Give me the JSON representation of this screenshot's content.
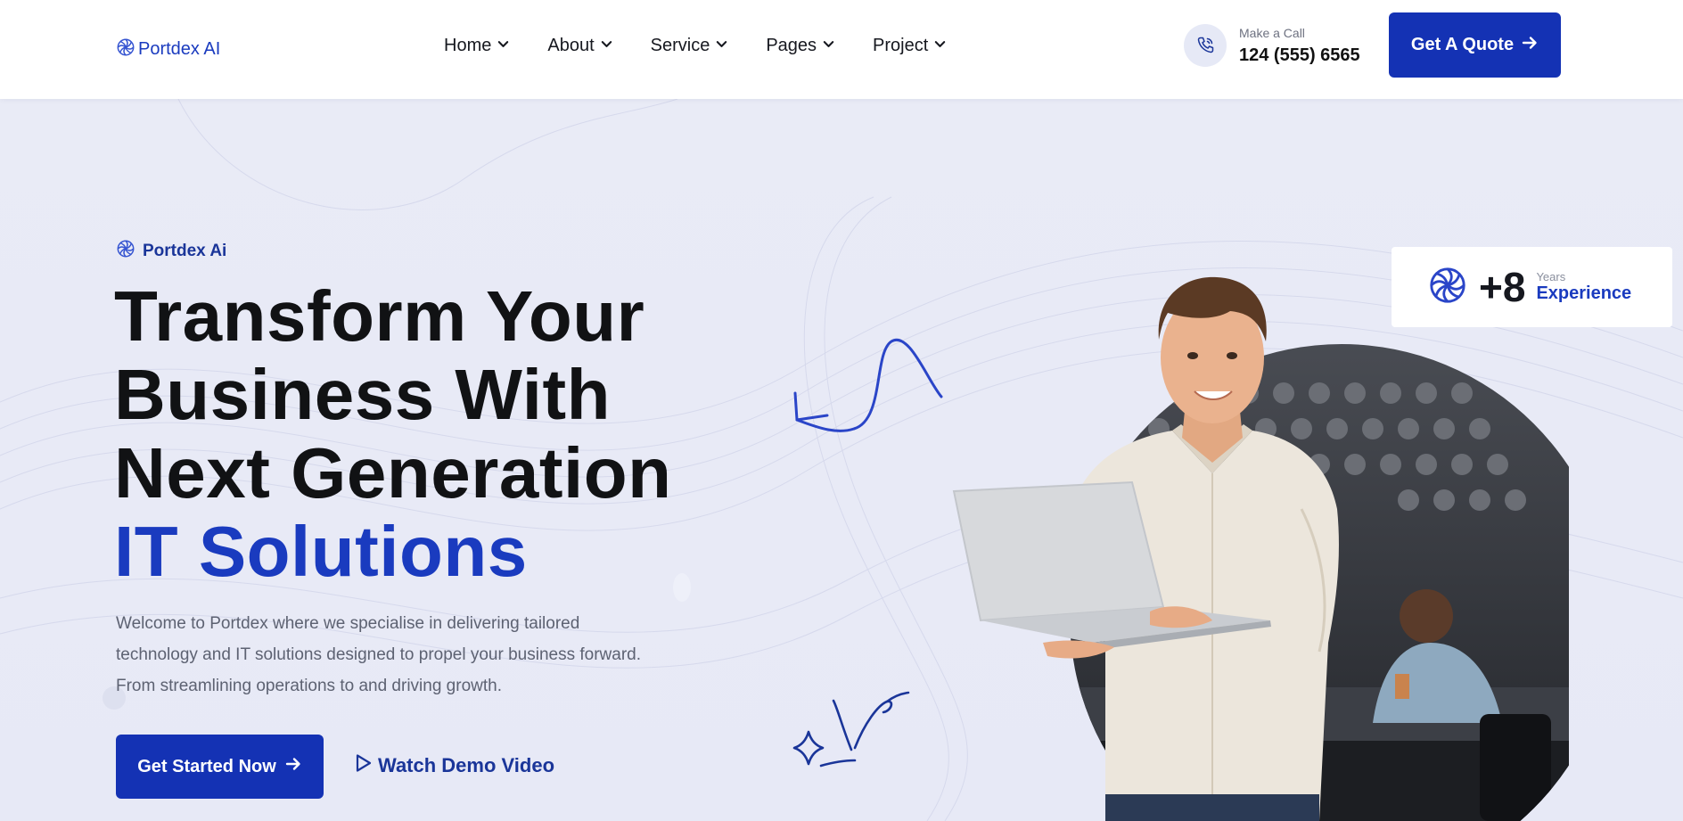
{
  "header": {
    "logo_text": "Portdex AI",
    "nav": [
      {
        "label": "Home"
      },
      {
        "label": "About"
      },
      {
        "label": "Service"
      },
      {
        "label": "Pages"
      },
      {
        "label": "Project"
      }
    ],
    "call": {
      "label": "Make a Call",
      "number": "124 (555) 6565"
    },
    "quote_button": "Get A Quote"
  },
  "hero": {
    "eyebrow": "Portdex Ai",
    "headline_lines": [
      "Transform Your",
      "Business With",
      "Next Generation"
    ],
    "headline_accent": "IT Solutions",
    "intro_lines": [
      "Welcome to Portdex where we specialise in delivering tailored",
      "technology and IT solutions designed to propel your business forward.",
      "From streamlining operations to and driving growth."
    ],
    "primary_button": "Get Started Now",
    "secondary_button": "Watch Demo Video",
    "experience": {
      "value": "+8",
      "years_label": "Years",
      "label": "Experience"
    }
  },
  "colors": {
    "brand_blue": "#1432b4",
    "accent_text": "#1a3bbf",
    "background": "#eceef8"
  },
  "icons": [
    "logo-swirl-icon",
    "chevron-down-icon",
    "phone-icon",
    "arrow-right-icon",
    "play-outline-icon",
    "squiggle-arrow-doodle",
    "sparkle-doodle"
  ]
}
